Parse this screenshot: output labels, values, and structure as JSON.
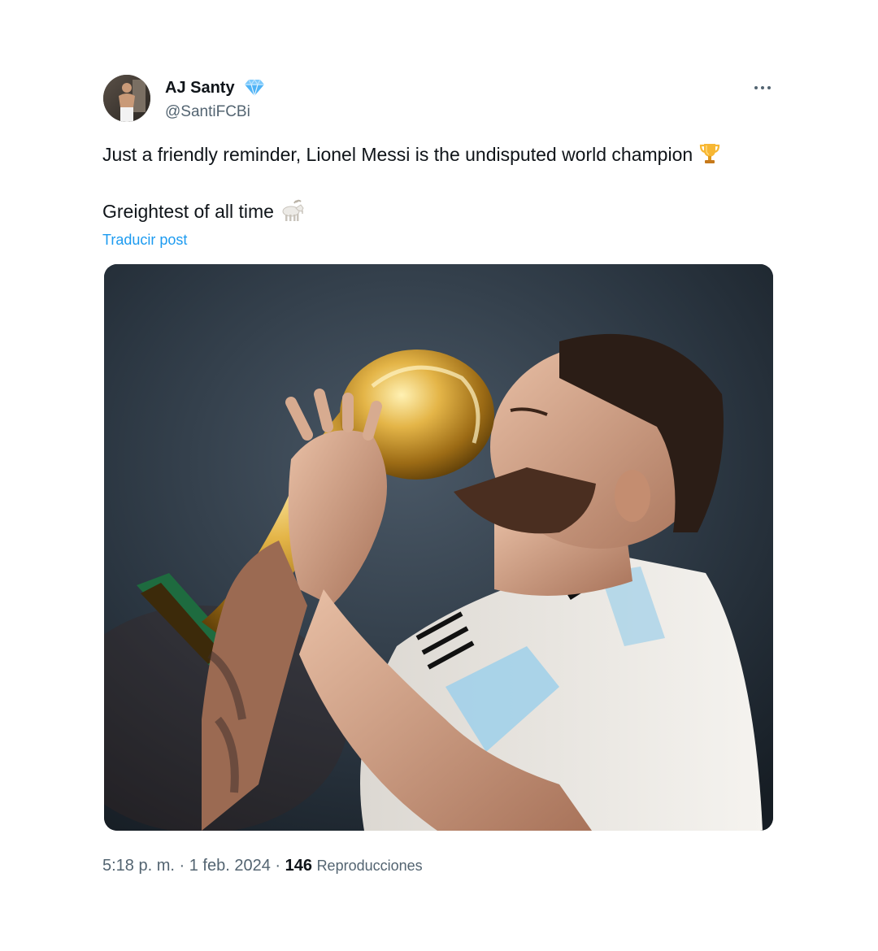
{
  "user": {
    "display_name": "AJ Santy",
    "handle": "@SantiFCBi",
    "badge_icon": "blue-diamond-icon"
  },
  "menu": {
    "more_icon": "more-horizontal-icon"
  },
  "tweet": {
    "line1": "Just a friendly reminder, Lionel Messi is the undisputed world champion",
    "line1_emoji": "trophy-icon",
    "line2": "Greightest of all time",
    "line2_emoji": "goat-icon",
    "translate_label": "Traducir post"
  },
  "media": {
    "subject": "player-kissing-trophy-photo"
  },
  "meta": {
    "time": "5:18 p. m.",
    "separator": "·",
    "date": "1 feb. 2024",
    "views_count": "146",
    "views_label": "Reproducciones"
  },
  "colors": {
    "text": "#0f1419",
    "secondary": "#536471",
    "link": "#1d9bf0",
    "badge": "#4fb3f6"
  }
}
